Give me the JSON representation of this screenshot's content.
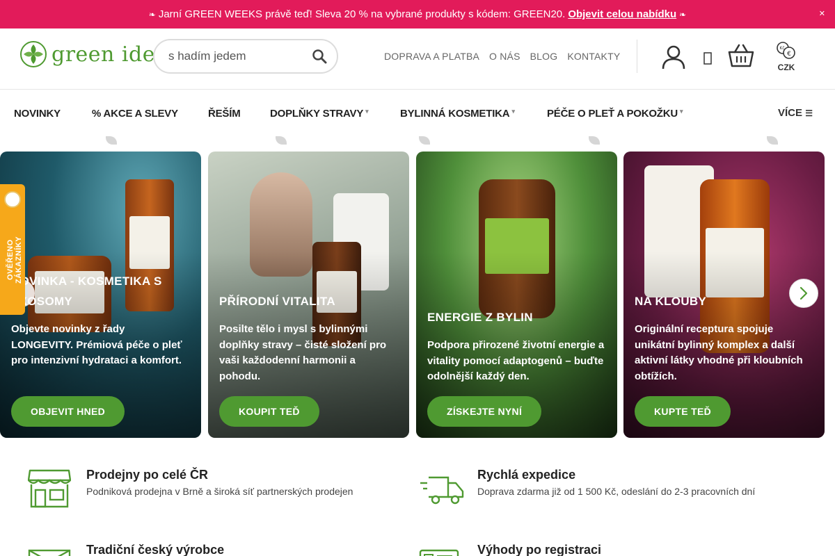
{
  "promo": {
    "text": "Jarní GREEN WEEKS právě teď! Sleva 20 % na vybrané produkty s kódem: GREEN20.",
    "link": "Objevit celou nabídku",
    "color": "#e21b5a"
  },
  "header": {
    "logo_text": "green idea",
    "search_placeholder": "s hadím jedem",
    "top_links": [
      "DOPRAVA A PLATBA",
      "O NÁS",
      "BLOG",
      "KONTAKTY"
    ],
    "currency": "CZK"
  },
  "nav": {
    "items": [
      "NOVINKY",
      "% AKCE A SLEVY",
      "ŘEŠÍM",
      "DOPLŇKY STRAVY",
      "BYLINNÁ KOSMETIKA",
      "PÉČE O PLEŤ A POKOŽKU"
    ],
    "more": "VÍCE"
  },
  "reviews_tab": "OVĚŘENO ZÁKAZNÍKY",
  "cards": [
    {
      "title_line1": "NOVINKA - KOSMETIKA S",
      "title_line2": "EXOSOMY",
      "desc": "Objevte novinky z řady LONGEVITY. Prémiová péče o pleť pro intenzivní hydrataci a komfort.",
      "cta": "OBJEVIT HNED"
    },
    {
      "title_line1": "PŘÍRODNÍ VITALITA",
      "desc": "Posilte tělo i mysl s bylinnými doplňky stravy – čisté složení pro vaši každodenní harmonii a pohodu.",
      "cta": "KOUPIT TEĎ"
    },
    {
      "title_line1": "ENERGIE Z BYLIN",
      "desc": "Podpora přirozené životní energie a vitality pomocí adaptogenů – buďte odolnější každý den.",
      "cta": "ZÍSKEJTE NYNÍ"
    },
    {
      "title_line1": "NA KLOUBY",
      "desc": "Originální receptura spojuje unikátní bylinný komplex a další aktivní látky vhodné při kloubních obtížích.",
      "cta": "KUPTE TEĎ"
    }
  ],
  "features": [
    {
      "title": "Prodejny po celé ČR",
      "desc": "Podniková prodejna v Brně a široká síť partnerských prodejen",
      "icon": "shop-icon"
    },
    {
      "title": "Rychlá expedice",
      "desc": "Doprava zdarma již od 1 500 Kč, odeslání do 2-3 pracovních dní",
      "icon": "delivery-truck-icon"
    },
    {
      "title": "Tradiční český výrobce",
      "desc": "",
      "icon": "envelope-icon"
    },
    {
      "title": "Výhody po registraci",
      "desc": "",
      "icon": "id-card-icon"
    }
  ],
  "colors": {
    "brand_green": "#4f9a31",
    "promo_pink": "#e21b5a",
    "reviews_orange": "#f6a81a"
  }
}
